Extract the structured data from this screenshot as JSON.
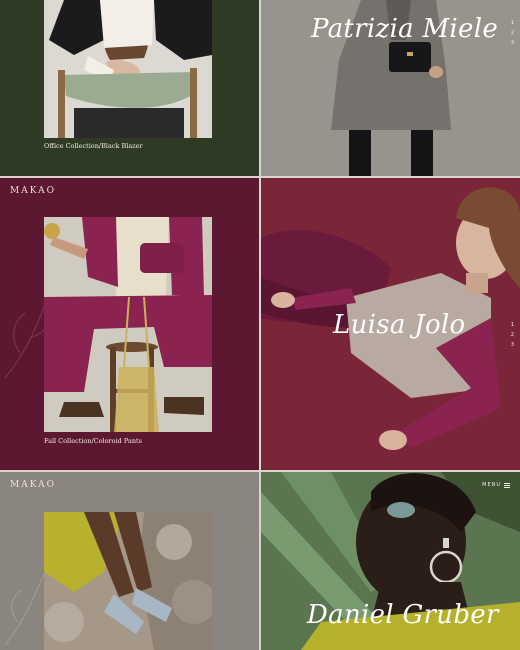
{
  "brand": "MAKAO",
  "menu_label": "MENU",
  "sections": [
    {
      "caption": "Office Collection/Black Blazer",
      "model_name": "Patrizia Miele",
      "pager": [
        "1",
        "2",
        "3"
      ],
      "colors": {
        "left_bg": "#2f3a25",
        "right_bg": "#8d8a85"
      }
    },
    {
      "caption": "Fall Collection/Coloroid Pants",
      "model_name": "Luisa Jolo",
      "pager": [
        "1",
        "2",
        "3"
      ],
      "colors": {
        "left_bg": "#5c1830",
        "right_bg": "#7a2238"
      }
    },
    {
      "model_name": "Daniel Gruber",
      "colors": {
        "left_bg": "#8b8580",
        "right_bg": "#4f6b3e"
      }
    }
  ],
  "icons": [
    "menu-icon",
    "leaf-outline-icon"
  ]
}
